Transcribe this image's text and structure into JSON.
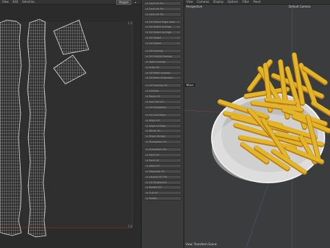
{
  "uv_editor": {
    "menu": [
      "View",
      "Edit",
      "Selection"
    ],
    "dropdown": "Project"
  },
  "side_panel": {
    "items": [
      "Lock UV Pin",
      "Lock UV Pin",
      "Lock UV Pin",
      "UV Select Edge Loop",
      "UV Select to Edge",
      "UV Select to Edge",
      "UV Select",
      "UV Select",
      "UV Unwrap",
      "UV Unfold Unwrap",
      "Weld Unwrap",
      "Auto UV",
      "UV Mesh Unwrap",
      "UV Mesh Projection",
      "UV Unwrap UV",
      "Unwrap",
      "Relax UV",
      "Iron Flat UV",
      "UV Straighten",
      "UV Grid Align",
      "Align UV",
      "Align to Edge",
      "Mirror UV",
      "Stack Similar",
      "Straighten UV",
      "Straighten Pts",
      "Pack UV",
      "Pack UV",
      "Weld UV",
      "Separate UV",
      "Layout UV Tile",
      "UV Singleshot",
      "Rotate UV",
      "Cut UV",
      "Rotate"
    ]
  },
  "viewport": {
    "menu": [
      "View",
      "Cameras",
      "Display",
      "Options",
      "Filter",
      "Panel"
    ],
    "title": "Perspective",
    "camera": "Default Camera",
    "move_tag": "Move",
    "footer": "View: Transform Scene"
  },
  "colors": {
    "fry": "#e3b62a",
    "fry_dark": "#b97d12",
    "plate": "#e8e8e8",
    "wire": "#e4e4e4"
  }
}
